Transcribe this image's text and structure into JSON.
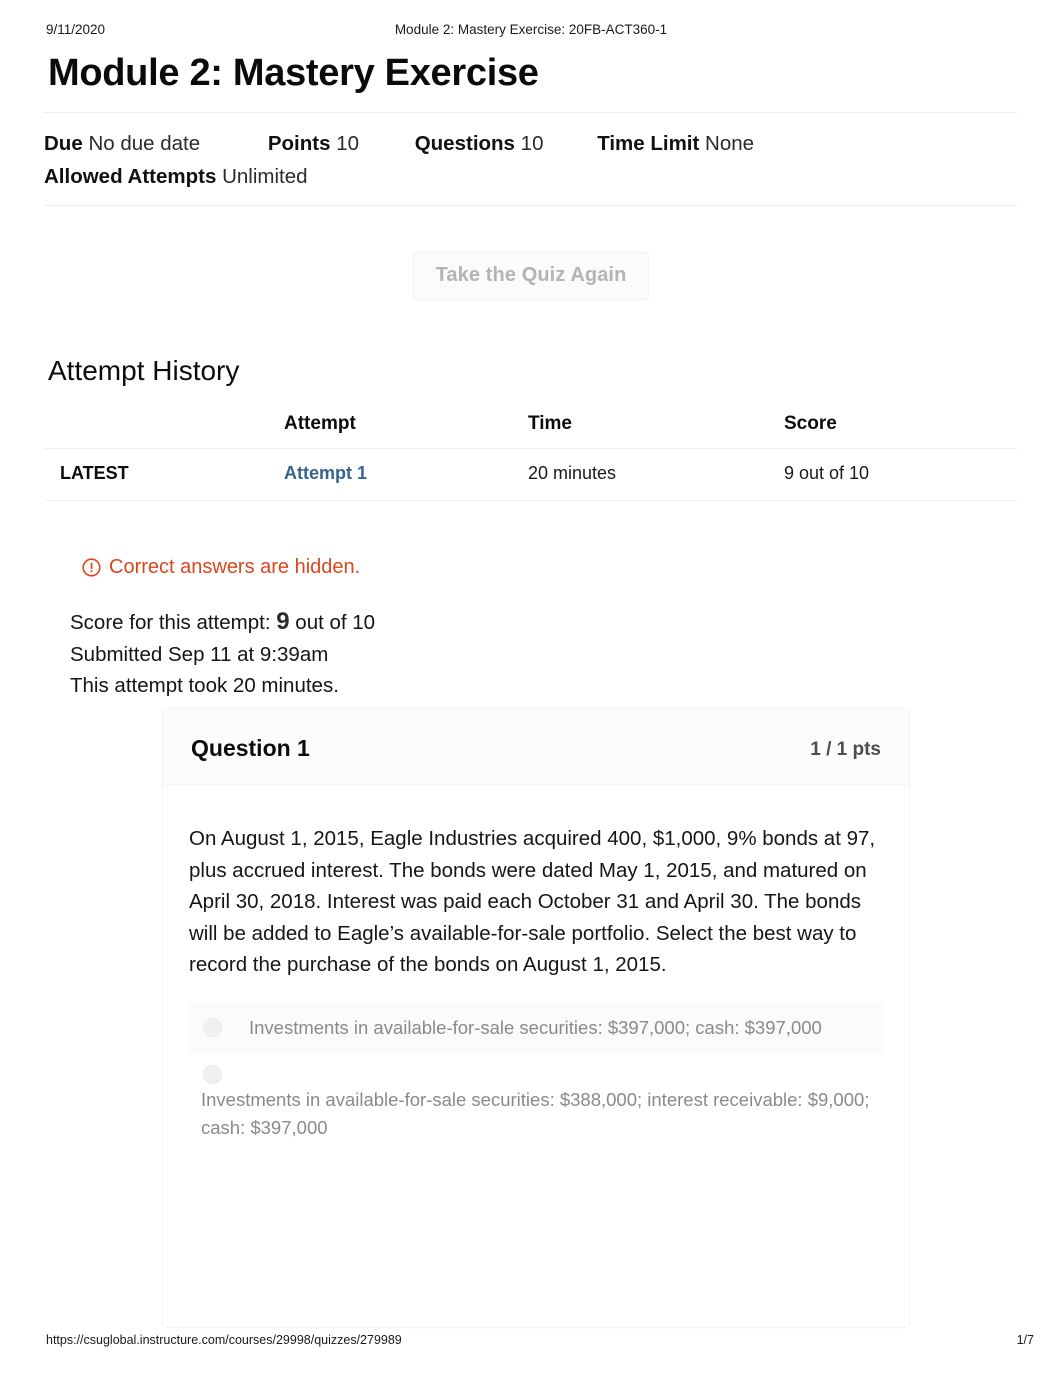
{
  "print_header": {
    "date": "9/11/2020",
    "document_title": "Module 2: Mastery Exercise: 20FB-ACT360-1"
  },
  "print_footer": {
    "url": "https://csuglobal.instructure.com/courses/29998/quizzes/279989",
    "page": "1/7"
  },
  "page_title": "Module 2: Mastery Exercise",
  "quiz_info": {
    "due_label": "Due",
    "due_value": "No due date",
    "points_label": "Points",
    "points_value": "10",
    "questions_label": "Questions",
    "questions_value": "10",
    "time_limit_label": "Time Limit",
    "time_limit_value": "None",
    "allowed_attempts_label": "Allowed Attempts",
    "allowed_attempts_value": "Unlimited"
  },
  "take_quiz_again_button": "Take the Quiz Again",
  "attempt_history": {
    "heading": "Attempt History",
    "columns": [
      "",
      "Attempt",
      "Time",
      "Score"
    ],
    "rows": [
      {
        "latest": "LATEST",
        "attempt": "Attempt 1",
        "time": "20 minutes",
        "score": "9 out of 10"
      }
    ]
  },
  "answers_hidden_notice": "Correct answers are hidden.",
  "score_summary": {
    "score_prefix": "Score for this attempt:",
    "score_value": "9",
    "score_suffix": "out of 10",
    "submitted": "Submitted Sep 11 at 9:39am",
    "duration": "This attempt took 20 minutes."
  },
  "question": {
    "name": "Question 1",
    "points": "1 / 1 pts",
    "text": "On August 1, 2015, Eagle Industries acquired 400, $1,000, 9% bonds at 97, plus accrued interest. The bonds were dated May 1, 2015, and matured on April 30, 2018. Interest was paid each October 31 and April 30. The bonds will be added to Eagle’s available-for-sale portfolio. Select the best way to record the purchase of the bonds on August 1, 2015.",
    "answers": [
      "Investments in available-for-sale securities: $397,000; cash: $397,000",
      "Investments in available-for-sale securities: $388,000; interest receivable: $9,000; cash: $397,000"
    ]
  },
  "colors": {
    "link_blue": "#39628f",
    "warning_orange": "#d9471d",
    "muted_gray": "#8a8a8a",
    "disabled_button_text": "#b4b4b4"
  }
}
